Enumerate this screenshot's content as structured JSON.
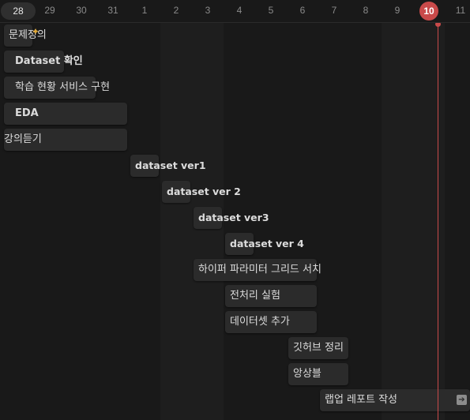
{
  "timeline": {
    "days": [
      "28",
      "29",
      "30",
      "31",
      "1",
      "2",
      "3",
      "4",
      "5",
      "6",
      "7",
      "8",
      "9",
      "10",
      "11"
    ],
    "today": "10"
  },
  "tasks": [
    {
      "label": "문제정의",
      "icon": "sparkle-icon"
    },
    {
      "label": "Dataset 확인"
    },
    {
      "label": "학습 현황 서비스 구현"
    },
    {
      "label": "EDA"
    },
    {
      "label": "강의듣기"
    },
    {
      "label": "dataset ver1"
    },
    {
      "label": "dataset ver 2"
    },
    {
      "label": "dataset ver3"
    },
    {
      "label": "dataset ver 4"
    },
    {
      "label": "하이퍼 파라미터 그리드 서치"
    },
    {
      "label": "전처리 실험"
    },
    {
      "label": "데이터셋 추가"
    },
    {
      "label": "깃허브 정리"
    },
    {
      "label": "앙상블"
    },
    {
      "label": "랩업 레포트 작성",
      "icon": "open-arrow-icon"
    }
  ],
  "colors": {
    "today": "#c94a4a",
    "bar": "#2b2b2b",
    "background": "#191919"
  }
}
